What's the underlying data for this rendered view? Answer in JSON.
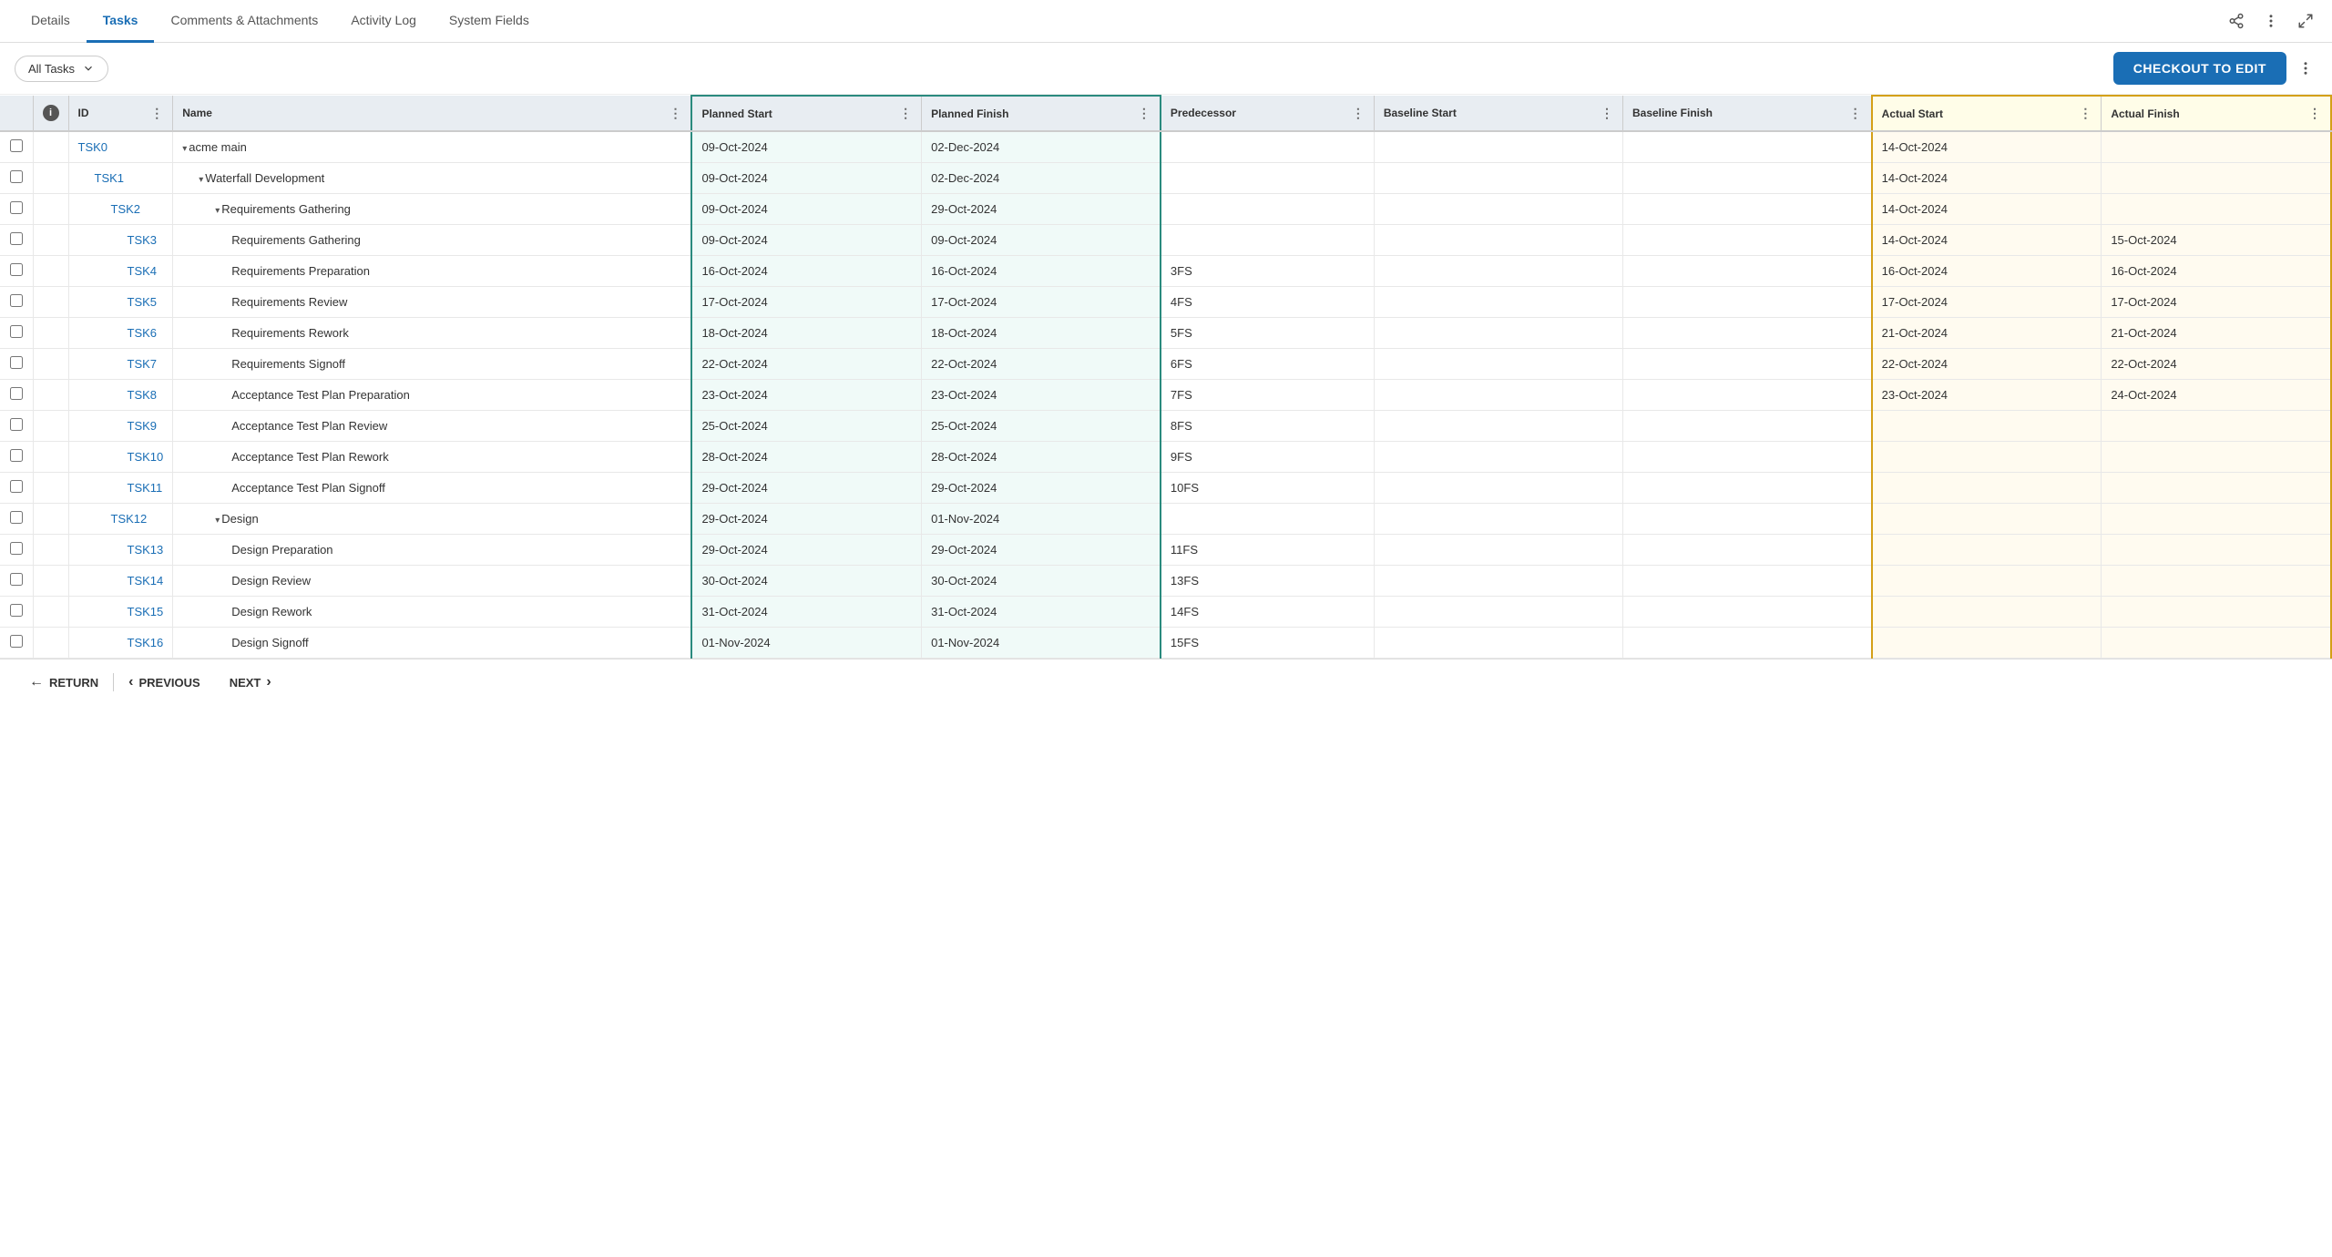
{
  "tabs": [
    {
      "id": "details",
      "label": "Details",
      "active": false
    },
    {
      "id": "tasks",
      "label": "Tasks",
      "active": true
    },
    {
      "id": "comments",
      "label": "Comments & Attachments",
      "active": false
    },
    {
      "id": "activity",
      "label": "Activity Log",
      "active": false
    },
    {
      "id": "system",
      "label": "System Fields",
      "active": false
    }
  ],
  "toolbar": {
    "filter_label": "All Tasks",
    "checkout_label": "CHECKOUT TO EDIT"
  },
  "columns": [
    {
      "id": "checkbox",
      "label": ""
    },
    {
      "id": "info",
      "label": ""
    },
    {
      "id": "id",
      "label": "ID"
    },
    {
      "id": "name",
      "label": "Name"
    },
    {
      "id": "planned_start",
      "label": "Planned Start"
    },
    {
      "id": "planned_finish",
      "label": "Planned Finish"
    },
    {
      "id": "predecessor",
      "label": "Predecessor"
    },
    {
      "id": "baseline_start",
      "label": "Baseline Start"
    },
    {
      "id": "baseline_finish",
      "label": "Baseline Finish"
    },
    {
      "id": "actual_start",
      "label": "Actual Start"
    },
    {
      "id": "actual_finish",
      "label": "Actual Finish"
    }
  ],
  "rows": [
    {
      "id": "TSK0",
      "name": "acme main",
      "indent": 0,
      "expand": true,
      "planned_start": "09-Oct-2024",
      "planned_finish": "02-Dec-2024",
      "predecessor": "",
      "baseline_start": "",
      "baseline_finish": "",
      "actual_start": "14-Oct-2024",
      "actual_finish": ""
    },
    {
      "id": "TSK1",
      "name": "Waterfall Development",
      "indent": 1,
      "expand": true,
      "planned_start": "09-Oct-2024",
      "planned_finish": "02-Dec-2024",
      "predecessor": "",
      "baseline_start": "",
      "baseline_finish": "",
      "actual_start": "14-Oct-2024",
      "actual_finish": ""
    },
    {
      "id": "TSK2",
      "name": "Requirements Gathering",
      "indent": 2,
      "expand": true,
      "planned_start": "09-Oct-2024",
      "planned_finish": "29-Oct-2024",
      "predecessor": "",
      "baseline_start": "",
      "baseline_finish": "",
      "actual_start": "14-Oct-2024",
      "actual_finish": ""
    },
    {
      "id": "TSK3",
      "name": "Requirements Gathering",
      "indent": 3,
      "expand": false,
      "planned_start": "09-Oct-2024",
      "planned_finish": "09-Oct-2024",
      "predecessor": "",
      "baseline_start": "",
      "baseline_finish": "",
      "actual_start": "14-Oct-2024",
      "actual_finish": "15-Oct-2024"
    },
    {
      "id": "TSK4",
      "name": "Requirements Preparation",
      "indent": 3,
      "expand": false,
      "planned_start": "16-Oct-2024",
      "planned_finish": "16-Oct-2024",
      "predecessor": "3FS",
      "baseline_start": "",
      "baseline_finish": "",
      "actual_start": "16-Oct-2024",
      "actual_finish": "16-Oct-2024"
    },
    {
      "id": "TSK5",
      "name": "Requirements Review",
      "indent": 3,
      "expand": false,
      "planned_start": "17-Oct-2024",
      "planned_finish": "17-Oct-2024",
      "predecessor": "4FS",
      "baseline_start": "",
      "baseline_finish": "",
      "actual_start": "17-Oct-2024",
      "actual_finish": "17-Oct-2024"
    },
    {
      "id": "TSK6",
      "name": "Requirements Rework",
      "indent": 3,
      "expand": false,
      "planned_start": "18-Oct-2024",
      "planned_finish": "18-Oct-2024",
      "predecessor": "5FS",
      "baseline_start": "",
      "baseline_finish": "",
      "actual_start": "21-Oct-2024",
      "actual_finish": "21-Oct-2024"
    },
    {
      "id": "TSK7",
      "name": "Requirements Signoff",
      "indent": 3,
      "expand": false,
      "planned_start": "22-Oct-2024",
      "planned_finish": "22-Oct-2024",
      "predecessor": "6FS",
      "baseline_start": "",
      "baseline_finish": "",
      "actual_start": "22-Oct-2024",
      "actual_finish": "22-Oct-2024"
    },
    {
      "id": "TSK8",
      "name": "Acceptance Test Plan Preparation",
      "indent": 3,
      "expand": false,
      "planned_start": "23-Oct-2024",
      "planned_finish": "23-Oct-2024",
      "predecessor": "7FS",
      "baseline_start": "",
      "baseline_finish": "",
      "actual_start": "23-Oct-2024",
      "actual_finish": "24-Oct-2024"
    },
    {
      "id": "TSK9",
      "name": "Acceptance Test Plan Review",
      "indent": 3,
      "expand": false,
      "planned_start": "25-Oct-2024",
      "planned_finish": "25-Oct-2024",
      "predecessor": "8FS",
      "baseline_start": "",
      "baseline_finish": "",
      "actual_start": "",
      "actual_finish": ""
    },
    {
      "id": "TSK10",
      "name": "Acceptance Test Plan Rework",
      "indent": 3,
      "expand": false,
      "planned_start": "28-Oct-2024",
      "planned_finish": "28-Oct-2024",
      "predecessor": "9FS",
      "baseline_start": "",
      "baseline_finish": "",
      "actual_start": "",
      "actual_finish": ""
    },
    {
      "id": "TSK11",
      "name": "Acceptance Test Plan Signoff",
      "indent": 3,
      "expand": false,
      "planned_start": "29-Oct-2024",
      "planned_finish": "29-Oct-2024",
      "predecessor": "10FS",
      "baseline_start": "",
      "baseline_finish": "",
      "actual_start": "",
      "actual_finish": ""
    },
    {
      "id": "TSK12",
      "name": "Design",
      "indent": 2,
      "expand": true,
      "planned_start": "29-Oct-2024",
      "planned_finish": "01-Nov-2024",
      "predecessor": "",
      "baseline_start": "",
      "baseline_finish": "",
      "actual_start": "",
      "actual_finish": ""
    },
    {
      "id": "TSK13",
      "name": "Design Preparation",
      "indent": 3,
      "expand": false,
      "planned_start": "29-Oct-2024",
      "planned_finish": "29-Oct-2024",
      "predecessor": "11FS",
      "baseline_start": "",
      "baseline_finish": "",
      "actual_start": "",
      "actual_finish": ""
    },
    {
      "id": "TSK14",
      "name": "Design Review",
      "indent": 3,
      "expand": false,
      "planned_start": "30-Oct-2024",
      "planned_finish": "30-Oct-2024",
      "predecessor": "13FS",
      "baseline_start": "",
      "baseline_finish": "",
      "actual_start": "",
      "actual_finish": ""
    },
    {
      "id": "TSK15",
      "name": "Design Rework",
      "indent": 3,
      "expand": false,
      "planned_start": "31-Oct-2024",
      "planned_finish": "31-Oct-2024",
      "predecessor": "14FS",
      "baseline_start": "",
      "baseline_finish": "",
      "actual_start": "",
      "actual_finish": ""
    },
    {
      "id": "TSK16",
      "name": "Design Signoff",
      "indent": 3,
      "expand": false,
      "planned_start": "01-Nov-2024",
      "planned_finish": "01-Nov-2024",
      "predecessor": "15FS",
      "baseline_start": "",
      "baseline_finish": "",
      "actual_start": "",
      "actual_finish": ""
    }
  ],
  "bottom_nav": {
    "return_label": "RETURN",
    "previous_label": "PREVIOUS",
    "next_label": "NEXT"
  }
}
